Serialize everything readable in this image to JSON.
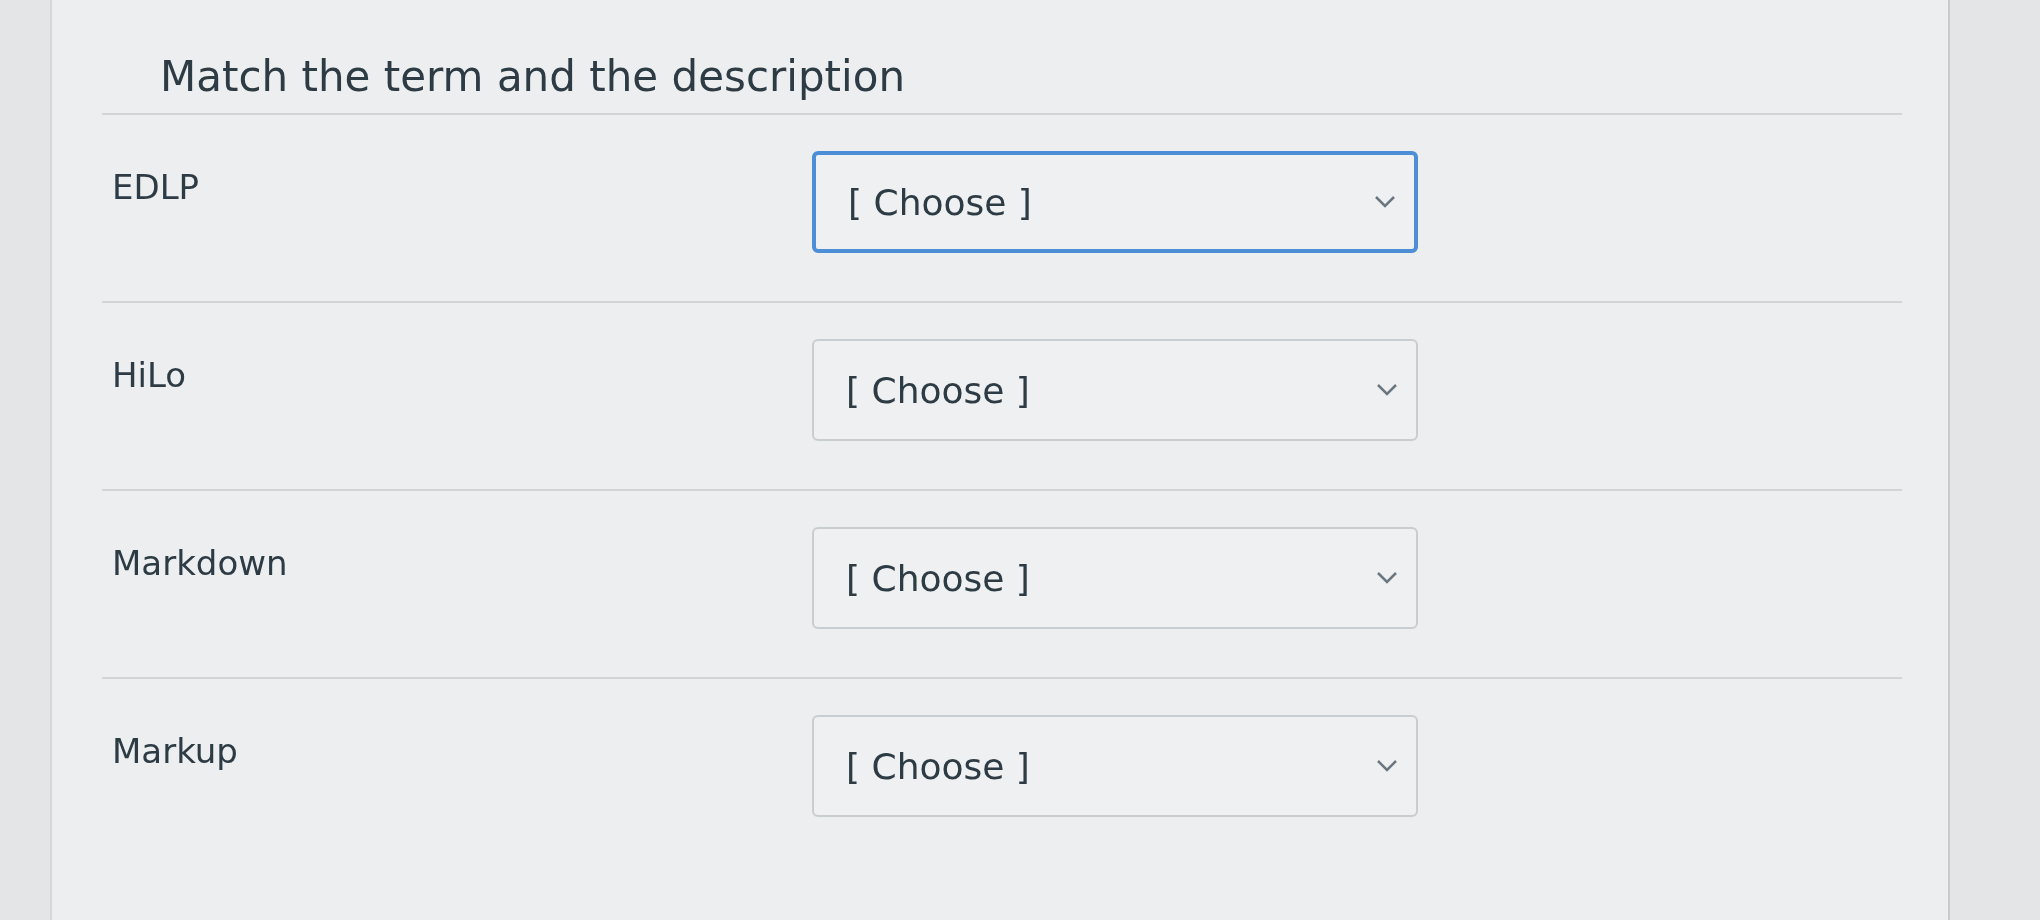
{
  "question": {
    "title": "Match the term and the description",
    "rows": [
      {
        "term": "EDLP",
        "value": "[ Choose ]",
        "focused": true
      },
      {
        "term": "HiLo",
        "value": "[ Choose ]",
        "focused": false
      },
      {
        "term": "Markdown",
        "value": "[ Choose ]",
        "focused": false
      },
      {
        "term": "Markup",
        "value": "[ Choose ]",
        "focused": false
      }
    ]
  }
}
